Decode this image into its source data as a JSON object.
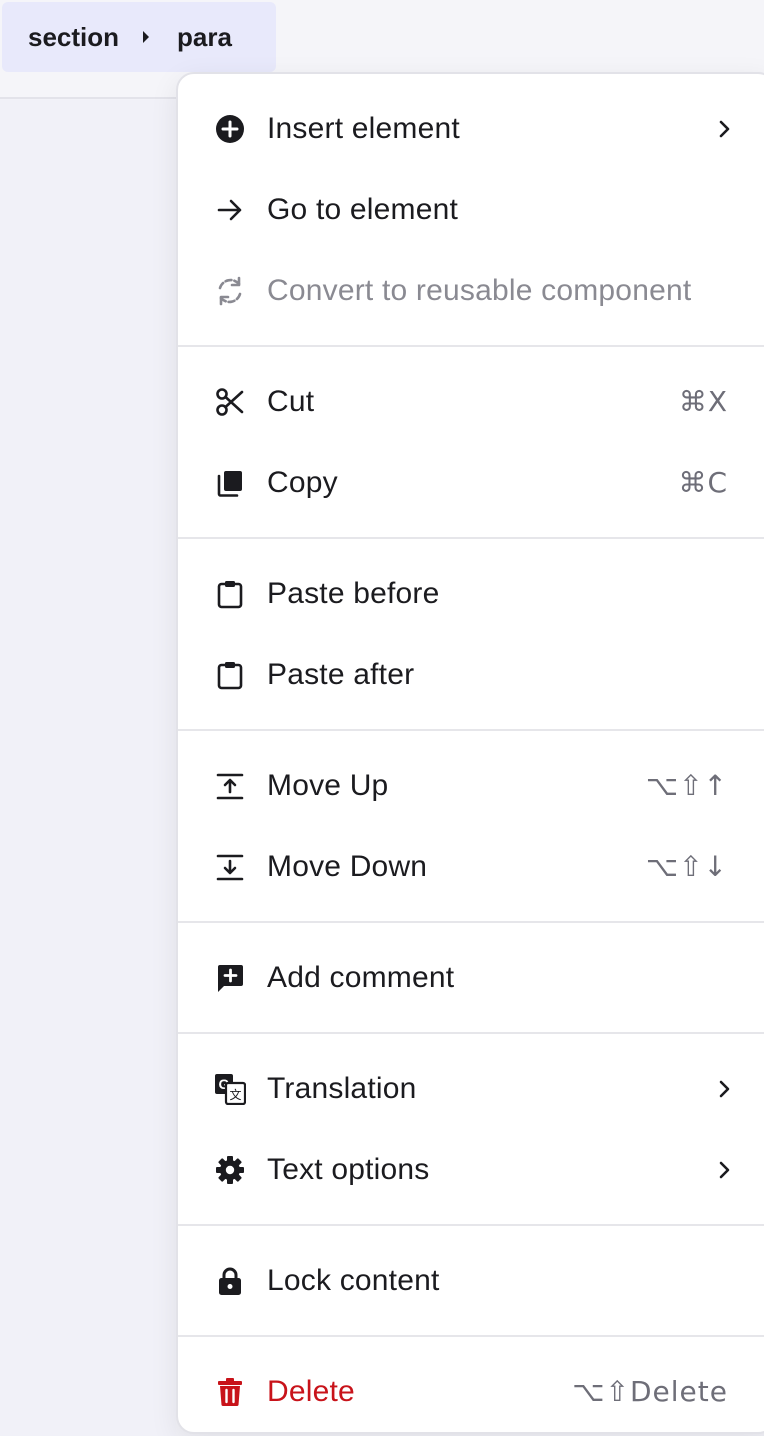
{
  "breadcrumb": {
    "items": [
      "section",
      "para"
    ]
  },
  "menu": {
    "insert_element": {
      "label": "Insert element",
      "icon": "plus-circle-icon"
    },
    "go_to_element": {
      "label": "Go to element",
      "icon": "arrow-right-icon"
    },
    "convert_reusable": {
      "label": "Convert to reusable component",
      "icon": "sync-icon",
      "disabled": true
    },
    "cut": {
      "label": "Cut",
      "shortcut": "⌘X",
      "icon": "scissors-icon"
    },
    "copy": {
      "label": "Copy",
      "shortcut": "⌘C",
      "icon": "copy-icon"
    },
    "paste_before": {
      "label": "Paste before",
      "icon": "clipboard-icon"
    },
    "paste_after": {
      "label": "Paste after",
      "icon": "clipboard-icon"
    },
    "move_up": {
      "label": "Move Up",
      "shortcut": "⌥⇧↑",
      "icon": "move-up-icon"
    },
    "move_down": {
      "label": "Move Down",
      "shortcut": "⌥⇧↓",
      "icon": "move-down-icon"
    },
    "add_comment": {
      "label": "Add comment",
      "icon": "comment-add-icon"
    },
    "translation": {
      "label": "Translation",
      "icon": "translate-icon"
    },
    "text_options": {
      "label": "Text options",
      "icon": "gear-icon"
    },
    "lock_content": {
      "label": "Lock content",
      "icon": "lock-icon"
    },
    "delete": {
      "label": "Delete",
      "shortcut": "⌥⇧Delete",
      "icon": "trash-icon"
    }
  },
  "colors": {
    "danger": "#c8131a",
    "disabled": "#8a8a92",
    "text": "#1b1b1f",
    "breadcrumb_bg": "#e8e9fb"
  }
}
